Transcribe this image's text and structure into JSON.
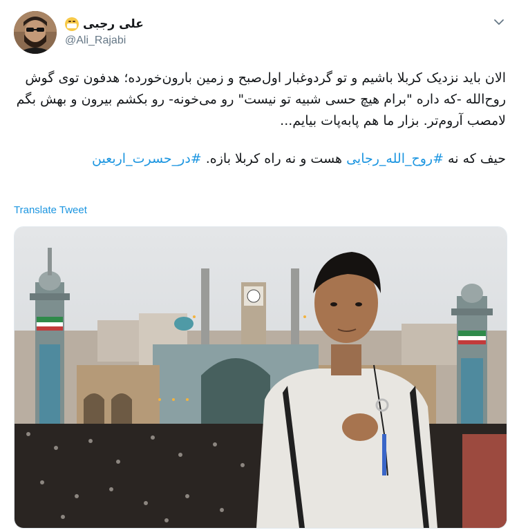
{
  "author": {
    "display_name": "علی رجبی",
    "handle": "@Ali_Rajabi",
    "name_emoji": "face-with-medical-mask"
  },
  "tweet": {
    "paragraph1": "الان باید نزدیک کربلا باشیم و تو گردوغبار اول‌صبح و زمین بارون‌خورده؛ هدفون توی گوش روح‌الله -که داره \"برام هیچ حسی شبیه تو نیست\" رو می‌خونه- رو بکشم بیرون و بهش بگم لامصب آروم‌تر. بزار ما هم پابه‌پات بیایم...",
    "paragraph2_part1": "حیف که نه ",
    "hashtag1": "#روح_الله_رجایی",
    "paragraph2_part2": " هست و نه راه کربلا بازه. ",
    "hashtag2": "#در_حسرت_اربعین",
    "translate_label": "Translate Tweet"
  },
  "colors": {
    "link": "#1b95e0",
    "text": "#14171a",
    "secondary": "#657786",
    "border": "#e1e8ed"
  },
  "icons": {
    "more_menu": "chevron-down-icon"
  }
}
